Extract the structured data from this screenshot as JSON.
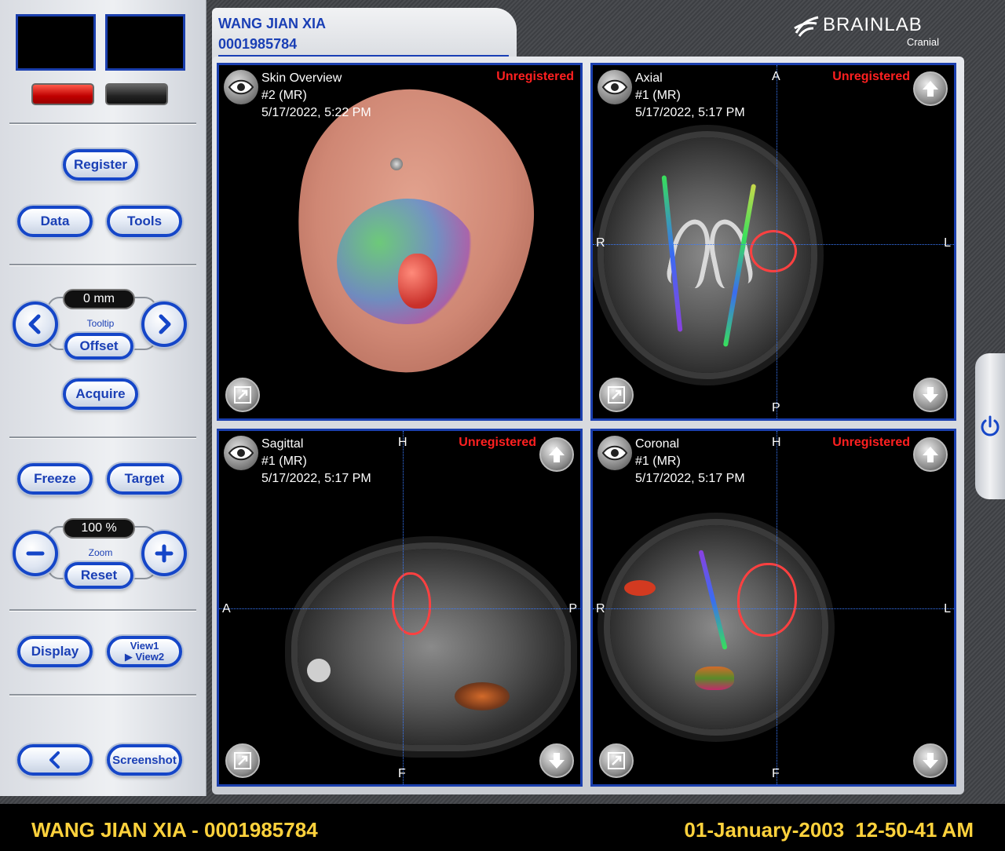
{
  "patient": {
    "name": "WANG JIAN XIA",
    "id": "0001985784"
  },
  "brand": {
    "name": "BRAINLAB",
    "product": "Cranial"
  },
  "left_panel": {
    "register": "Register",
    "data": "Data",
    "tools": "Tools",
    "tooltip": {
      "value": "0 mm",
      "label": "Tooltip",
      "offset": "Offset"
    },
    "acquire": "Acquire",
    "freeze": "Freeze",
    "target": "Target",
    "zoom": {
      "value": "100 %",
      "label": "Zoom",
      "reset": "Reset"
    },
    "display": "Display",
    "view_toggle": {
      "line1": "View1",
      "line2": "▶ View2"
    },
    "screenshot": "Screenshot"
  },
  "viewports": [
    {
      "name": "Skin Overview",
      "series": "#2 (MR)",
      "datetime": "5/17/2022, 5:22 PM",
      "status": "Unregistered"
    },
    {
      "name": "Axial",
      "series": "#1 (MR)",
      "datetime": "5/17/2022, 5:17 PM",
      "status": "Unregistered",
      "orient": {
        "top": "A",
        "bottom": "P",
        "left": "R",
        "right": "L"
      }
    },
    {
      "name": "Sagittal",
      "series": "#1 (MR)",
      "datetime": "5/17/2022, 5:17 PM",
      "status": "Unregistered",
      "orient": {
        "top": "H",
        "bottom": "F",
        "left": "A",
        "right": "P"
      }
    },
    {
      "name": "Coronal",
      "series": "#1 (MR)",
      "datetime": "5/17/2022, 5:17 PM",
      "status": "Unregistered",
      "orient": {
        "top": "H",
        "bottom": "F",
        "left": "R",
        "right": "L"
      }
    }
  ],
  "footer": {
    "patient_line": "WANG JIAN XIA - 0001985784",
    "date": "01-January-2003",
    "time": "12-50-41 AM"
  },
  "colors": {
    "accent": "#1546c8",
    "status": "#ff2020",
    "footer_text": "#ffd23c"
  }
}
